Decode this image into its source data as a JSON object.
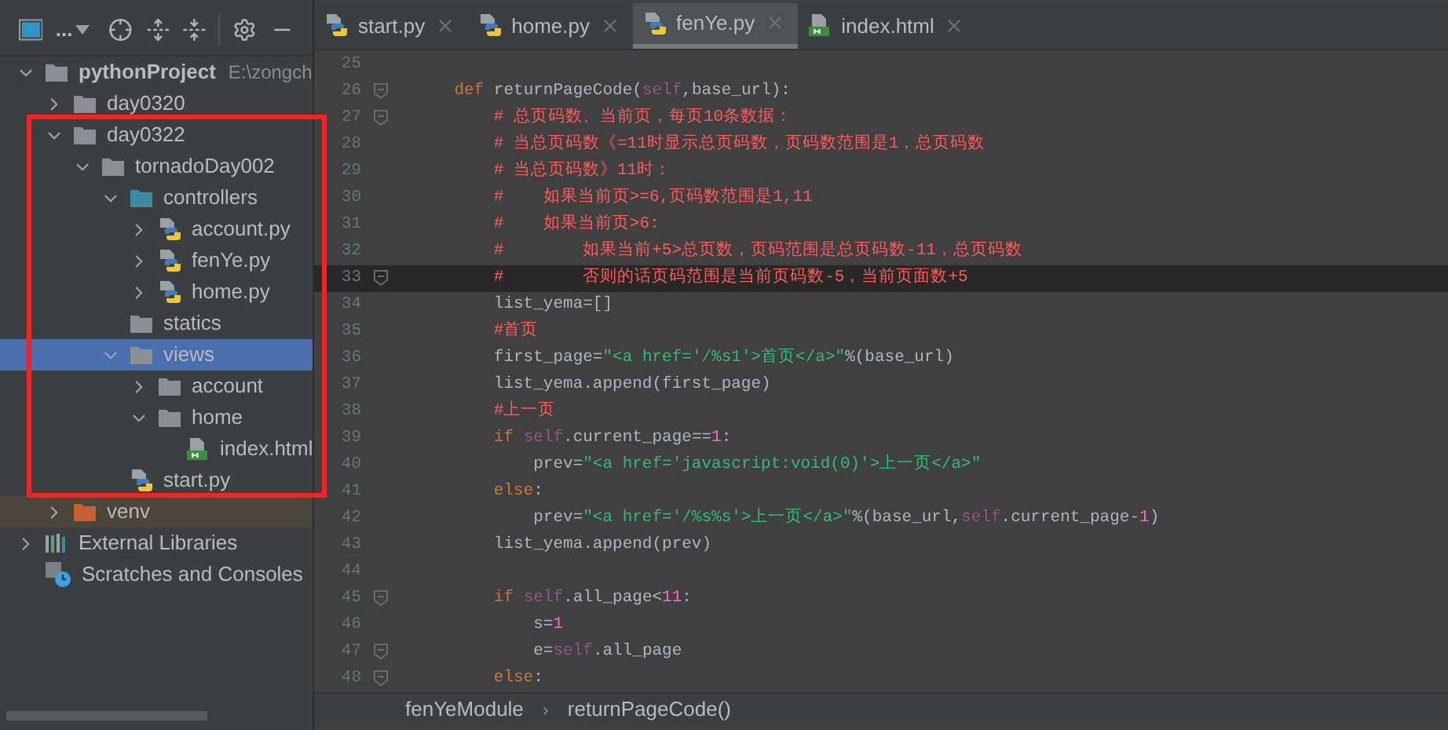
{
  "project_toolbar": {
    "view_label": "..."
  },
  "tree": [
    {
      "label": "pythonProject",
      "path": "E:\\zongch",
      "kind": "folder",
      "bold": true,
      "expanded": true,
      "selected": false,
      "children": [
        {
          "label": "day0320",
          "kind": "folder",
          "expanded": false,
          "selected": false
        },
        {
          "label": "day0322",
          "kind": "folder",
          "expanded": true,
          "selected": false,
          "children": [
            {
              "label": "tornadoDay002",
              "kind": "folder",
              "expanded": true,
              "selected": false,
              "children": [
                {
                  "label": "controllers",
                  "kind": "source-folder",
                  "expanded": true,
                  "selected": false,
                  "children": [
                    {
                      "label": "account.py",
                      "kind": "python",
                      "expanded": false,
                      "selected": false
                    },
                    {
                      "label": "fenYe.py",
                      "kind": "python",
                      "expanded": false,
                      "selected": false
                    },
                    {
                      "label": "home.py",
                      "kind": "python",
                      "expanded": false,
                      "selected": false
                    }
                  ]
                },
                {
                  "label": "statics",
                  "kind": "folder",
                  "selected": false
                },
                {
                  "label": "views",
                  "kind": "folder",
                  "expanded": true,
                  "selected": true,
                  "children": [
                    {
                      "label": "account",
                      "kind": "folder",
                      "expanded": false,
                      "selected": false
                    },
                    {
                      "label": "home",
                      "kind": "folder",
                      "expanded": true,
                      "selected": false,
                      "children": [
                        {
                          "label": "index.html",
                          "kind": "html",
                          "selected": false
                        }
                      ]
                    }
                  ]
                },
                {
                  "label": "start.py",
                  "kind": "python",
                  "selected": false
                }
              ]
            }
          ]
        },
        {
          "label": "venv",
          "kind": "excluded-folder",
          "expanded": false,
          "selected": false
        }
      ]
    },
    {
      "label": "External Libraries",
      "kind": "library",
      "expanded": false,
      "selected": false
    },
    {
      "label": "Scratches and Consoles",
      "kind": "scratches",
      "selected": false
    }
  ],
  "tabs": [
    {
      "label": "start.py",
      "kind": "python",
      "selected": false
    },
    {
      "label": "home.py",
      "kind": "python",
      "selected": false
    },
    {
      "label": "fenYe.py",
      "kind": "python",
      "selected": true
    },
    {
      "label": "index.html",
      "kind": "html",
      "selected": false
    }
  ],
  "code": [
    {
      "number": "25",
      "current": false,
      "fold": false
    },
    {
      "number": "26",
      "current": false,
      "fold": true,
      "tokens": [
        {
          "kind": "keyword",
          "text": "    def"
        },
        {
          "kind": "plain",
          "text": " returnPageCode("
        },
        {
          "kind": "self",
          "text": "self"
        },
        {
          "kind": "plain",
          "text": ",base_url):"
        }
      ]
    },
    {
      "number": "27",
      "current": false,
      "fold": true,
      "tokens": [
        {
          "kind": "comment",
          "text": "        # 总页码数、当前页，每页10条数据："
        }
      ]
    },
    {
      "number": "28",
      "current": false,
      "fold": false,
      "tokens": [
        {
          "kind": "comment",
          "text": "        # 当总页码数《=11时显示总页码数，页码数范围是1，总页码数"
        }
      ]
    },
    {
      "number": "29",
      "current": false,
      "fold": false,
      "tokens": [
        {
          "kind": "comment",
          "text": "        # 当总页码数》11时："
        }
      ]
    },
    {
      "number": "30",
      "current": false,
      "fold": false,
      "tokens": [
        {
          "kind": "comment",
          "text": "        #    如果当前页>=6,页码数范围是1,11"
        }
      ]
    },
    {
      "number": "31",
      "current": false,
      "fold": false,
      "tokens": [
        {
          "kind": "comment",
          "text": "        #    如果当前页>6:"
        }
      ]
    },
    {
      "number": "32",
      "current": false,
      "fold": false,
      "tokens": [
        {
          "kind": "comment",
          "text": "        #        如果当前+5>总页数，页码范围是总页码数-11，总页码数"
        }
      ]
    },
    {
      "number": "33",
      "current": true,
      "fold": true,
      "tokens": [
        {
          "kind": "comment",
          "text": "        #        否则的话页码范围是当前页码数-5，当前页面数+5"
        }
      ]
    },
    {
      "number": "34",
      "current": false,
      "fold": false,
      "tokens": [
        {
          "kind": "plain",
          "text": "        list_yema=[]"
        }
      ]
    },
    {
      "number": "35",
      "current": false,
      "fold": false,
      "tokens": [
        {
          "kind": "comment",
          "text": "        #首页"
        }
      ]
    },
    {
      "number": "36",
      "current": false,
      "fold": false,
      "tokens": [
        {
          "kind": "plain",
          "text": "        first_page="
        },
        {
          "kind": "string",
          "text": "\"<a href='/%s1'>首页</a>\""
        },
        {
          "kind": "plain",
          "text": "%(base_url)"
        }
      ]
    },
    {
      "number": "37",
      "current": false,
      "fold": false,
      "tokens": [
        {
          "kind": "plain",
          "text": "        list_yema.append(first_page)"
        }
      ]
    },
    {
      "number": "38",
      "current": false,
      "fold": false,
      "tokens": [
        {
          "kind": "comment",
          "text": "        #上一页"
        }
      ]
    },
    {
      "number": "39",
      "current": false,
      "fold": false,
      "tokens": [
        {
          "kind": "keyword",
          "text": "        if"
        },
        {
          "kind": "self",
          "text": " self"
        },
        {
          "kind": "plain",
          "text": ".current_page=="
        },
        {
          "kind": "number",
          "text": "1"
        },
        {
          "kind": "plain",
          "text": ":"
        }
      ]
    },
    {
      "number": "40",
      "current": false,
      "fold": false,
      "tokens": [
        {
          "kind": "plain",
          "text": "            prev="
        },
        {
          "kind": "string",
          "text": "\"<a href='javascript:void(0)'>上一页</a>\""
        }
      ]
    },
    {
      "number": "41",
      "current": false,
      "fold": false,
      "tokens": [
        {
          "kind": "keyword",
          "text": "        else"
        },
        {
          "kind": "plain",
          "text": ":"
        }
      ]
    },
    {
      "number": "42",
      "current": false,
      "fold": false,
      "tokens": [
        {
          "kind": "plain",
          "text": "            prev="
        },
        {
          "kind": "string",
          "text": "\"<a href='/%s%s'>上一页</a>\""
        },
        {
          "kind": "plain",
          "text": "%(base_url,"
        },
        {
          "kind": "self",
          "text": "self"
        },
        {
          "kind": "plain",
          "text": ".current_page-"
        },
        {
          "kind": "number",
          "text": "1"
        },
        {
          "kind": "plain",
          "text": ")"
        }
      ]
    },
    {
      "number": "43",
      "current": false,
      "fold": false,
      "tokens": [
        {
          "kind": "plain",
          "text": "        list_yema.append(prev)"
        }
      ]
    },
    {
      "number": "44",
      "current": false,
      "fold": false
    },
    {
      "number": "45",
      "current": false,
      "fold": true,
      "tokens": [
        {
          "kind": "keyword",
          "text": "        if"
        },
        {
          "kind": "self",
          "text": " self"
        },
        {
          "kind": "plain",
          "text": ".all_page<"
        },
        {
          "kind": "number",
          "text": "11"
        },
        {
          "kind": "plain",
          "text": ":"
        }
      ]
    },
    {
      "number": "46",
      "current": false,
      "fold": false,
      "tokens": [
        {
          "kind": "plain",
          "text": "            s="
        },
        {
          "kind": "number",
          "text": "1"
        }
      ]
    },
    {
      "number": "47",
      "current": false,
      "fold": true,
      "tokens": [
        {
          "kind": "plain",
          "text": "            e="
        },
        {
          "kind": "self",
          "text": "self"
        },
        {
          "kind": "plain",
          "text": ".all_page"
        }
      ]
    },
    {
      "number": "48",
      "current": false,
      "fold": true,
      "tokens": [
        {
          "kind": "keyword",
          "text": "        else"
        },
        {
          "kind": "plain",
          "text": ":"
        }
      ]
    }
  ],
  "breadcrumb": [
    {
      "label": "fenYeModule"
    },
    {
      "label": "returnPageCode()"
    }
  ],
  "breadcrumb_separator": "›"
}
